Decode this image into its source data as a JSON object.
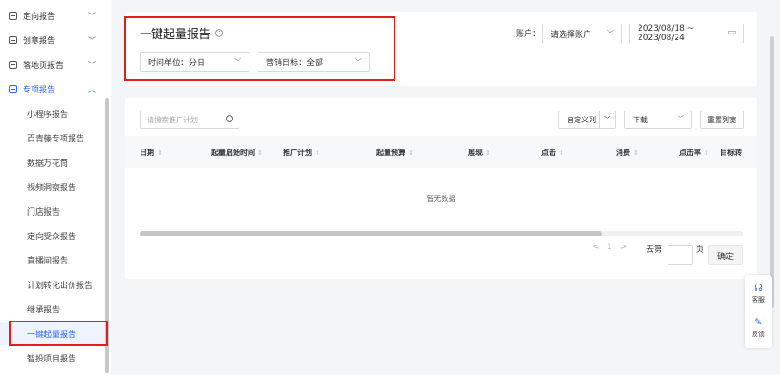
{
  "sidebar": {
    "groups": [
      {
        "label": "定向报告"
      },
      {
        "label": "创意报告"
      },
      {
        "label": "落地页报告"
      },
      {
        "label": "专项报告"
      }
    ],
    "sub_items": [
      {
        "label": "小程序报告"
      },
      {
        "label": "百青藤专项报告"
      },
      {
        "label": "数据万花筒"
      },
      {
        "label": "视频洞察报告"
      },
      {
        "label": "门店报告"
      },
      {
        "label": "定向受众报告"
      },
      {
        "label": "直播间报告"
      },
      {
        "label": "计划转化出价报告"
      },
      {
        "label": "继承报告"
      },
      {
        "label": "一键起量报告"
      },
      {
        "label": "智投项目报告"
      }
    ],
    "chevron_down": "﹀",
    "chevron_up": "︿"
  },
  "header": {
    "title": "一键起量报告",
    "help_glyph": "?",
    "time_unit": "时间单位：分日",
    "marketing_goal": "营销目标：全部",
    "account_label": "账户：",
    "account_placeholder": "请选择账户",
    "date_range": "2023/08/18 ~ 2023/08/24"
  },
  "table": {
    "search_placeholder": "请搜索推广计划",
    "custom_columns": "自定义列",
    "download": "下载",
    "reset_width": "重置列宽",
    "columns": [
      "日期",
      "起量启始时间",
      "推广计划",
      "起量预算",
      "展现",
      "点击",
      "消费",
      "点击率",
      "目标转"
    ],
    "sort_glyph": "⇕",
    "empty_text": "暂无数据"
  },
  "pager": {
    "prev": "<",
    "current": "1",
    "next": ">",
    "goto_prefix": "去第",
    "goto_suffix": "页",
    "confirm": "确定"
  },
  "float_tools": {
    "service": "客服",
    "feedback": "反馈"
  },
  "colors": {
    "accent": "#2f6cf6",
    "highlight_box": "#e02020"
  }
}
